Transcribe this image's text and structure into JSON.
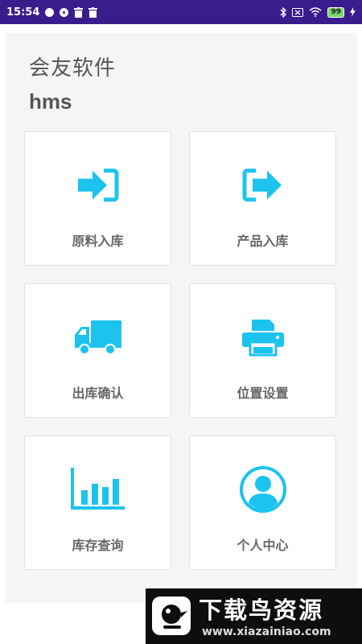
{
  "status_bar": {
    "time": "15:54",
    "battery": "99",
    "icons": [
      "notification-dot-icon",
      "notification-ring-icon",
      "trash-icon",
      "trash-icon",
      "bluetooth-icon",
      "sim-off-icon",
      "wifi-icon",
      "battery-icon",
      "charging-icon"
    ]
  },
  "header": {
    "title": "会友软件",
    "subtitle": "hms"
  },
  "menu": {
    "accent_color": "#1cc3ef",
    "items": [
      {
        "label": "原料入库",
        "icon": "sign-in-icon"
      },
      {
        "label": "产品入库",
        "icon": "sign-out-icon"
      },
      {
        "label": "出库确认",
        "icon": "truck-icon"
      },
      {
        "label": "位置设置",
        "icon": "printer-icon"
      },
      {
        "label": "库存查询",
        "icon": "bar-chart-icon"
      },
      {
        "label": "个人中心",
        "icon": "user-circle-icon"
      }
    ]
  },
  "watermark": {
    "title": "下载鸟资源",
    "url": "www.xiazainiao.com"
  }
}
